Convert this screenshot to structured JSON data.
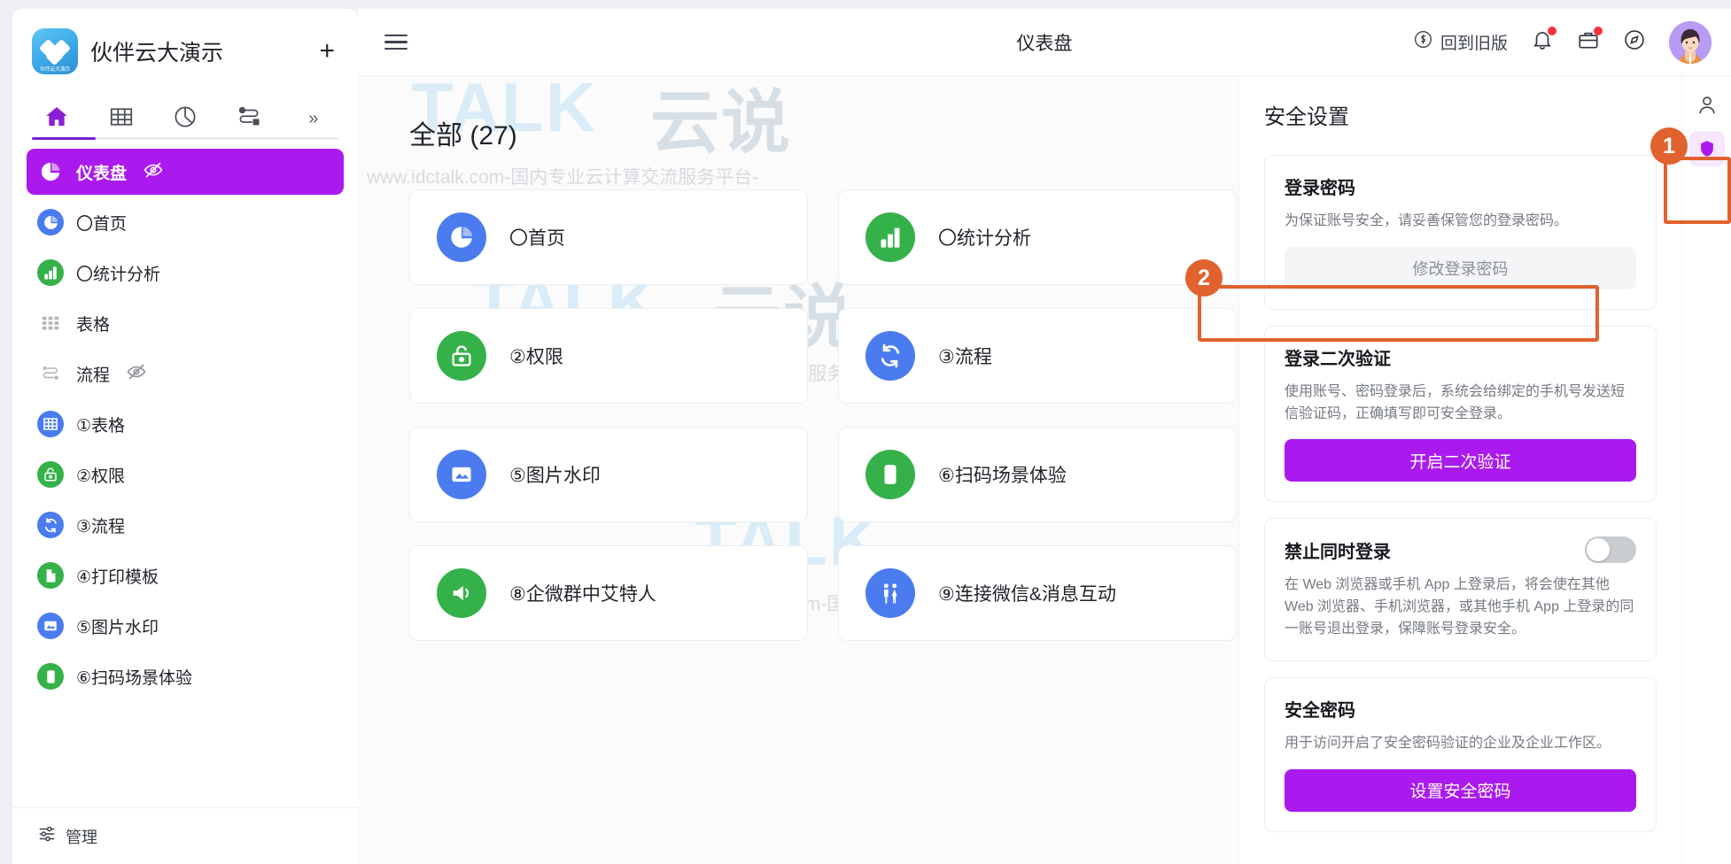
{
  "workspace": {
    "title": "伙伴云大演示",
    "logo_caption": "伙伴云大演示",
    "add_label": "+",
    "tabs": [
      {
        "name": "home-tab",
        "icon": "home-icon",
        "active": true
      },
      {
        "name": "table-tab",
        "icon": "grid-icon",
        "active": false
      },
      {
        "name": "dashboard-tab",
        "icon": "pie-chart-icon",
        "active": false
      },
      {
        "name": "flow-tab",
        "icon": "flow-icon",
        "active": false
      },
      {
        "name": "more-tab",
        "icon": "chevron-double-right-icon",
        "active": false
      }
    ],
    "nav_items": [
      {
        "label": "仪表盘",
        "icon": "pie-chart-icon",
        "color": "#ffffff",
        "bg": "none",
        "active": true,
        "hidden_badge": true
      },
      {
        "label": "〇首页",
        "icon": "pie-chart-icon",
        "color": "#ffffff",
        "bg": "#4a7cf0",
        "active": false,
        "hidden_badge": false
      },
      {
        "label": "〇统计分析",
        "icon": "bar-chart-icon",
        "color": "#ffffff",
        "bg": "#35b14a",
        "active": false,
        "hidden_badge": false
      },
      {
        "label": "表格",
        "icon": "grid-dots-icon",
        "color": "#b2b6bc",
        "bg": "none",
        "active": false,
        "hidden_badge": false
      },
      {
        "label": "流程",
        "icon": "flow-icon",
        "color": "#b2b6bc",
        "bg": "none",
        "active": false,
        "hidden_badge": true
      },
      {
        "label": "①表格",
        "icon": "table-icon",
        "color": "#ffffff",
        "bg": "#4a7cf0",
        "active": false,
        "hidden_badge": false
      },
      {
        "label": "②权限",
        "icon": "lock-icon",
        "color": "#ffffff",
        "bg": "#35b14a",
        "active": false,
        "hidden_badge": false
      },
      {
        "label": "③流程",
        "icon": "refresh-icon",
        "color": "#ffffff",
        "bg": "#4a7cf0",
        "active": false,
        "hidden_badge": false
      },
      {
        "label": "④打印模板",
        "icon": "file-icon",
        "color": "#ffffff",
        "bg": "#35b14a",
        "active": false,
        "hidden_badge": false
      },
      {
        "label": "⑤图片水印",
        "icon": "image-icon",
        "color": "#ffffff",
        "bg": "#4a7cf0",
        "active": false,
        "hidden_badge": false
      },
      {
        "label": "⑥扫码场景体验",
        "icon": "mobile-icon",
        "color": "#ffffff",
        "bg": "#35b14a",
        "active": false,
        "hidden_badge": false
      }
    ],
    "manage_label": "管理"
  },
  "topbar": {
    "menu_icon": "hamburger-icon",
    "page_title": "仪表盘",
    "old_version_label": "回到旧版",
    "old_version_icon": "revert-icon",
    "bell_icon": "bell-icon",
    "inbox_icon": "briefcase-icon",
    "compass_icon": "compass-icon",
    "avatar_icon": "user-avatar"
  },
  "content": {
    "all_title": "全部 (27)",
    "cards": [
      {
        "label": "〇首页",
        "icon": "pie-chart-icon",
        "bg": "#4a7cf0"
      },
      {
        "label": "〇统计分析",
        "icon": "bar-chart-icon",
        "bg": "#35b14a"
      },
      {
        "label": "②权限",
        "icon": "lock-icon",
        "bg": "#35b14a"
      },
      {
        "label": "③流程",
        "icon": "refresh-icon",
        "bg": "#4a7cf0"
      },
      {
        "label": "⑤图片水印",
        "icon": "image-icon",
        "bg": "#4a7cf0"
      },
      {
        "label": "⑥扫码场景体验",
        "icon": "mobile-icon",
        "bg": "#35b14a"
      },
      {
        "label": "⑧企微群中艾特人",
        "icon": "speaker-icon",
        "bg": "#35b14a"
      },
      {
        "label": "⑨连接微信&消息互动",
        "icon": "people-icon",
        "bg": "#4a7cf0"
      }
    ]
  },
  "security": {
    "heading": "安全设置",
    "cards": [
      {
        "title": "登录密码",
        "desc": "为保证账号安全，请妥善保管您的登录密码。",
        "button": "修改登录密码",
        "button_style": "grey",
        "toggle": false
      },
      {
        "title": "登录二次验证",
        "desc": "使用账号、密码登录后，系统会给绑定的手机号发送短信验证码，正确填写即可安全登录。",
        "button": "开启二次验证",
        "button_style": "purple",
        "toggle": false
      },
      {
        "title": "禁止同时登录",
        "desc": "在 Web 浏览器或手机 App 上登录后，将会使在其他 Web 浏览器、手机浏览器，或其他手机 App 上登录的同一账号退出登录，保障账号登录安全。",
        "button": "",
        "button_style": "none",
        "toggle": true
      },
      {
        "title": "安全密码",
        "desc": "用于访问开启了安全密码验证的企业及企业工作区。",
        "button": "设置安全密码",
        "button_style": "purple",
        "toggle": false
      }
    ]
  },
  "rail": {
    "items": [
      {
        "icon": "person-icon",
        "selected": false
      },
      {
        "icon": "shield-icon",
        "selected": true
      }
    ]
  },
  "annotations": [
    {
      "number": "1"
    },
    {
      "number": "2"
    }
  ],
  "watermarks": {
    "brand_latin": "TALK",
    "brand_cjk": "云说",
    "url1": "www.idctalk.com-国内专业云计算交流服务平台-",
    "url2": "-www.idctalk.com-国内专业云计算交流服务平台-",
    "url3": "-www.idctalk.com-国内专业云计算交流服务平台-"
  },
  "colors": {
    "accent_purple": "#aa1aee",
    "anno_orange": "#e1622e",
    "blue_icon": "#4a7cf0",
    "green_icon": "#35b14a",
    "status_red": "#f5323f"
  }
}
